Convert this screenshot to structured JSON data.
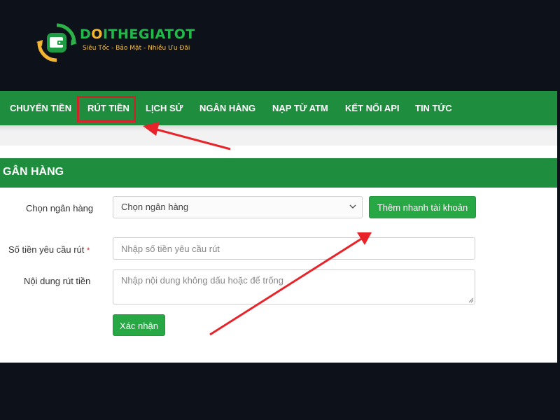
{
  "brand": {
    "name_part1": "D",
    "name_o": "O",
    "name_part2": "ITHEGIATOT",
    "tagline": "Siêu Tốc - Bảo Mật - Nhiều Ưu Đãi"
  },
  "navbar": {
    "items": [
      {
        "label": "CHUYỂN TIỀN"
      },
      {
        "label": "RÚT TIỀN"
      },
      {
        "label": "LỊCH SỬ"
      },
      {
        "label": "NGÂN HÀNG"
      },
      {
        "label": "NẠP TỪ ATM"
      },
      {
        "label": "KẾT NỐI API"
      },
      {
        "label": "TIN TỨC"
      }
    ],
    "highlighted_item": "RÚT TIỀN"
  },
  "form": {
    "section_title": "GÂN HÀNG",
    "bank_label": "Chọn ngân hàng",
    "bank_select_value": "Chọn ngân hàng",
    "quick_add_button": "Thêm nhanh tài khoản",
    "amount_label": "Số tiền yêu cầu rút",
    "amount_required_mark": "*",
    "amount_placeholder": "Nhập số tiền yêu cầu rút",
    "content_label": "Nội dung rút tiền",
    "content_placeholder": "Nhập nội dung không dấu hoặc để trống",
    "submit_button": "Xác nhận"
  },
  "colors": {
    "green_primary": "#1e8e3e",
    "button_green": "#28a745",
    "annotation_red": "#d2232a",
    "background": "#0d111a"
  },
  "icons": {
    "logo": "wallet-logo-icon",
    "select": "chevron-down-icon",
    "textarea": "resize-grip-icon"
  }
}
